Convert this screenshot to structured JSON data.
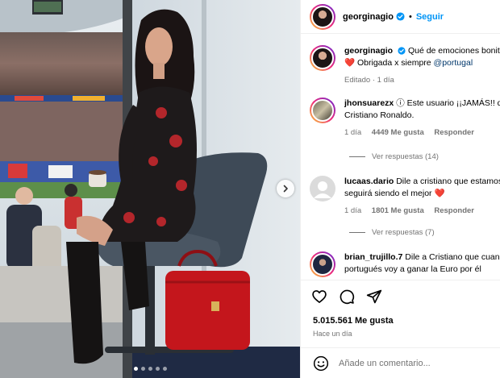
{
  "post": {
    "username": "georginagio",
    "follow_label": "Seguir",
    "separator": "•"
  },
  "caption": {
    "username": "georginagio",
    "text": "Qué de emociones bonitas en esta Eurocopa",
    "heart": "❤️",
    "text2": "Obrigada x siempre",
    "mention": "@portugal",
    "meta": "Editado · 1 día"
  },
  "comments": [
    {
      "username": "jhonsuarezx",
      "text_line1": "ⓘ Este usuario ¡¡JAMÁS!! dejará de amar a",
      "text_line2": "Cristiano Ronaldo.",
      "time": "1 día",
      "likes": "4449 Me gusta",
      "reply": "Responder",
      "view_replies": "Ver respuestas (14)"
    },
    {
      "username": "lucaas.dario",
      "text_line1": "Dile a cristiano que estamos con el, y que",
      "text_line2": "seguirá siendo el mejor",
      "heart": "❤️",
      "time": "1 día",
      "likes": "1801 Me gusta",
      "reply": "Responder",
      "view_replies": "Ver respuestas (7)"
    },
    {
      "username": "brian_trujillo.7",
      "text_line1": "Dile a Cristiano que cuando sea un",
      "text_line2": "portugués voy a ganar la Euro por él"
    }
  ],
  "stats": {
    "likes": "5.015.561 Me gusta",
    "time": "Hace un día"
  },
  "add_comment": {
    "placeholder": "Añade un comentario..."
  },
  "carousel": {
    "slide_count": 5,
    "active_slide": 1
  },
  "colors": {
    "accent": "#0095f6",
    "heart": "#ed4956",
    "muted": "#737373",
    "bag": "#c4161c"
  }
}
